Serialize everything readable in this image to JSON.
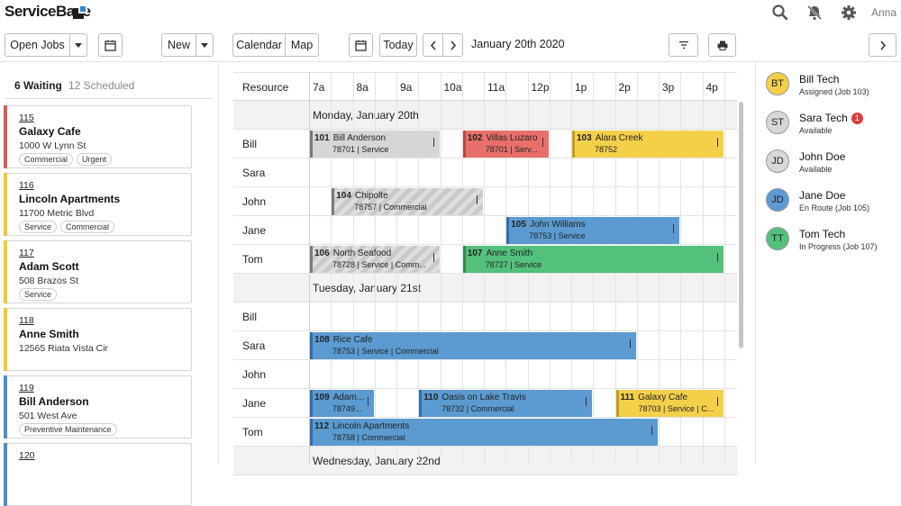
{
  "app": {
    "brand": "ServiceBase",
    "user": "Anna"
  },
  "toolbar": {
    "open_jobs": "Open Jobs",
    "new": "New",
    "calendar": "Calendar",
    "map": "Map",
    "today": "Today",
    "date": "January 20th 2020"
  },
  "left_panel": {
    "tab_waiting": "6 Waiting",
    "tab_scheduled": "12 Scheduled",
    "cards": [
      {
        "num": "115",
        "name": "Galaxy Cafe",
        "address": "1000 W Lynn St",
        "tags": [
          "Commercial",
          "Urgent"
        ],
        "color": "#e05a55"
      },
      {
        "num": "116",
        "name": "Lincoln Apartments",
        "address": "11700 Metric Blvd",
        "tags": [
          "Service",
          "Commercial"
        ],
        "color": "#f1c933"
      },
      {
        "num": "117",
        "name": "Adam Scott",
        "address": "508 Brazos St",
        "tags": [
          "Service"
        ],
        "color": "#f1c933"
      },
      {
        "num": "118",
        "name": "Anne Smith",
        "address": "12565 Riata Vista Cir",
        "tags": [],
        "color": "#f1c933"
      },
      {
        "num": "119",
        "name": "Bill Anderson",
        "address": "501 West Ave",
        "tags": [
          "Preventive Maintenance"
        ],
        "color": "#4a8fcb"
      },
      {
        "num": "120",
        "name": "",
        "address": "",
        "tags": [],
        "color": "#4a8fcb"
      }
    ]
  },
  "grid": {
    "resource_label": "Resource",
    "hours": [
      "7a",
      "8a",
      "9a",
      "10a",
      "11a",
      "12p",
      "1p",
      "2p",
      "3p",
      "4p"
    ],
    "days": [
      {
        "label": "Monday, January 20th",
        "rows": [
          {
            "name": "Bill",
            "jobs": [
              {
                "num": "101",
                "title": "Bill Anderson",
                "sub": "78701 | Service",
                "color": "grey",
                "start": 7.0,
                "end": 10.0
              },
              {
                "num": "102",
                "title": "Villas Luzaro",
                "sub": "78701 | Serv...",
                "color": "red",
                "start": 10.5,
                "end": 12.5
              },
              {
                "num": "103",
                "title": "Alara Creek",
                "sub": "78752",
                "color": "yellow",
                "start": 13.0,
                "end": 16.5
              }
            ]
          },
          {
            "name": "Sara",
            "jobs": []
          },
          {
            "name": "John",
            "jobs": [
              {
                "num": "104",
                "title": "Chipolte",
                "sub": "78757 | Commercial",
                "color": "hatch",
                "start": 7.5,
                "end": 11.0
              }
            ]
          },
          {
            "name": "Jane",
            "jobs": [
              {
                "num": "105",
                "title": "John Williams",
                "sub": "78753 | Service",
                "color": "blue",
                "start": 11.5,
                "end": 15.5
              }
            ]
          },
          {
            "name": "Tom",
            "jobs": [
              {
                "num": "106",
                "title": "North Seafood",
                "sub": "78728 | Service | Comm...",
                "color": "hatch",
                "start": 7.0,
                "end": 10.0
              },
              {
                "num": "107",
                "title": "Anne Smith",
                "sub": "78727 | Service",
                "color": "green",
                "start": 10.5,
                "end": 16.5
              }
            ]
          }
        ]
      },
      {
        "label": "Tuesday, January 21st",
        "rows": [
          {
            "name": "Bill",
            "jobs": []
          },
          {
            "name": "Sara",
            "jobs": [
              {
                "num": "108",
                "title": "Rice Cafe",
                "sub": "78753 | Service | Commercial",
                "color": "blue",
                "start": 7.0,
                "end": 14.5
              }
            ]
          },
          {
            "name": "John",
            "jobs": []
          },
          {
            "name": "Jane",
            "jobs": [
              {
                "num": "109",
                "title": "Adam...",
                "sub": "78749...",
                "color": "blue",
                "start": 7.0,
                "end": 8.5
              },
              {
                "num": "110",
                "title": "Oasis on Lake Travis",
                "sub": "78732 | Commercial",
                "color": "blue",
                "start": 9.5,
                "end": 13.5
              },
              {
                "num": "111",
                "title": "Galaxy Cafe",
                "sub": "78703 | Service | C...",
                "color": "yellow",
                "start": 14.0,
                "end": 16.5
              }
            ]
          },
          {
            "name": "Tom",
            "jobs": [
              {
                "num": "112",
                "title": "Lincoln Apartments",
                "sub": "78758 | Commercial",
                "color": "blue",
                "start": 7.0,
                "end": 15.0
              }
            ]
          }
        ]
      },
      {
        "label": "Wednesday, January 22nd",
        "rows": []
      }
    ]
  },
  "techs": [
    {
      "initials": "BT",
      "name": "Bill Tech",
      "status": "Assigned (Job 103)",
      "color": "#f4d04a",
      "badge": ""
    },
    {
      "initials": "ST",
      "name": "Sara Tech",
      "status": "Available",
      "color": "#d8d8d8",
      "badge": "1"
    },
    {
      "initials": "JD",
      "name": "John Doe",
      "status": "Available",
      "color": "#d8d8d8",
      "badge": ""
    },
    {
      "initials": "JD",
      "name": "Jane Doe",
      "status": "En Route (Job 105)",
      "color": "#5b9bd1",
      "badge": ""
    },
    {
      "initials": "TT",
      "name": "Tom Tech",
      "status": "In Progress (Job 107)",
      "color": "#53c07c",
      "badge": ""
    }
  ]
}
